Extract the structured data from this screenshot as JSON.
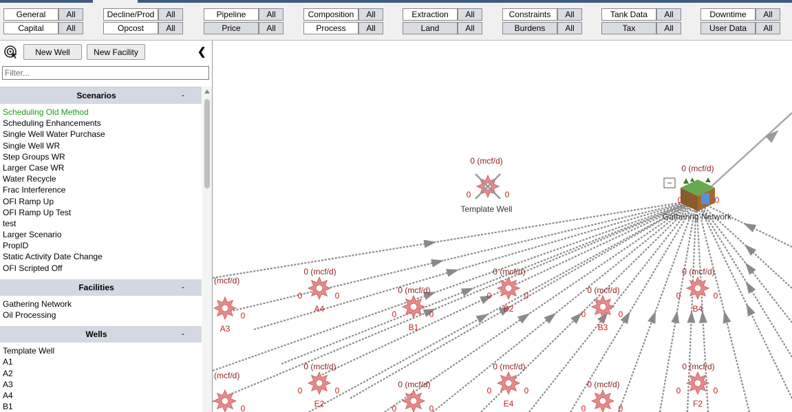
{
  "toolbar": {
    "groups": [
      {
        "top": {
          "label": "General",
          "all": "All"
        },
        "bottom": {
          "label": "Capital",
          "all": "All"
        }
      },
      {
        "top": {
          "label": "Decline/Prod",
          "all": "All"
        },
        "bottom": {
          "label": "Opcost",
          "all": "All"
        }
      },
      {
        "top": {
          "label": "Pipeline",
          "all": "All"
        },
        "bottom": {
          "label": "Price",
          "all": "All"
        }
      },
      {
        "top": {
          "label": "Composition",
          "all": "All"
        },
        "bottom": {
          "label": "Process",
          "all": "All"
        }
      },
      {
        "top": {
          "label": "Extraction",
          "all": "All"
        },
        "bottom": {
          "label": "Land",
          "all": "All"
        }
      },
      {
        "top": {
          "label": "Constraints",
          "all": "All"
        },
        "bottom": {
          "label": "Burdens",
          "all": "All"
        }
      },
      {
        "top": {
          "label": "Tank Data",
          "all": "All"
        },
        "bottom": {
          "label": "Tax",
          "all": "All"
        }
      },
      {
        "top": {
          "label": "Downtime",
          "all": "All"
        },
        "bottom": {
          "label": "User Data",
          "all": "All"
        }
      }
    ]
  },
  "sidebar": {
    "new_well": "New Well",
    "new_facility": "New Facility",
    "filter_placeholder": "Filter...",
    "collapse_glyph": "❮",
    "sections": [
      {
        "title": "Scenarios",
        "toggle": "-",
        "items": [
          "Scheduling Old Method",
          "Scheduling Enhancements",
          "Single Well Water Purchase",
          "Single Well WR",
          "Step Groups WR",
          "Larger Case WR",
          "Water Recycle",
          "Frac Interference",
          "OFI Ramp Up",
          "OFI Ramp Up Test",
          "test",
          "Larger Scenario",
          "PropID",
          "Static Activity Date Change",
          "OFI Scripted Off"
        ],
        "selected": 0
      },
      {
        "title": "Facilities",
        "toggle": "-",
        "items": [
          "Gathering Network",
          "Oil Processing"
        ],
        "selected": -1
      },
      {
        "title": "Wells",
        "toggle": "-",
        "items": [
          "Template Well",
          "A1",
          "A2",
          "A3",
          "A4",
          "B1"
        ],
        "selected": -1
      }
    ]
  },
  "canvas": {
    "rate_label": "0 (mcf/d)",
    "partial_rate_label": "(mcf/d)",
    "zero": "0",
    "template_well": "Template Well",
    "gathering_network": "Gathering Network",
    "collapse_box": "−",
    "well_names": [
      "A3",
      "A4",
      "B1",
      "B2",
      "B3",
      "B4",
      "E2",
      "E4",
      "F2"
    ],
    "colors": {
      "well": "#e58a8a",
      "edge": "#8c8c8c",
      "label": "#c82020"
    }
  }
}
